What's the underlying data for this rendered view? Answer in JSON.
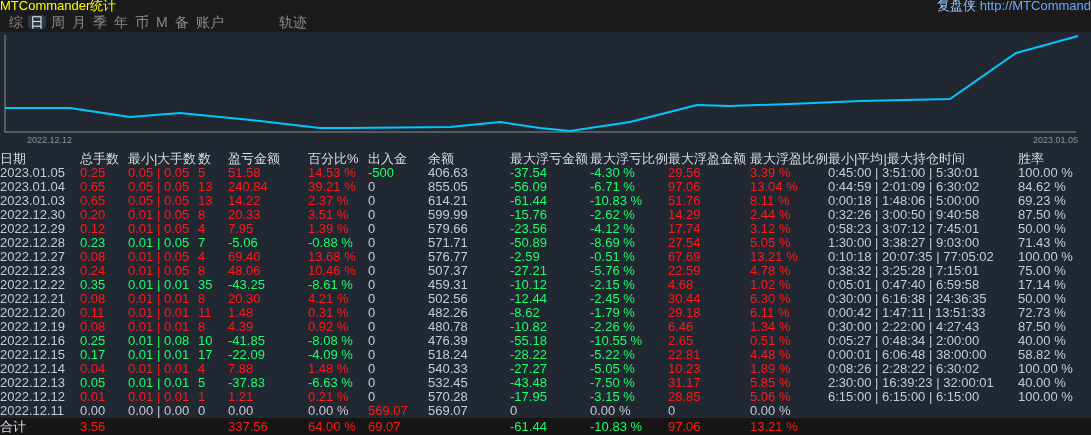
{
  "header": {
    "title": "MTCommander统计",
    "brand": "复盘侠",
    "link": "http://MTCommand"
  },
  "tabs": [
    {
      "label": "综",
      "selected": false
    },
    {
      "label": "日",
      "selected": true
    },
    {
      "label": "周",
      "selected": false
    },
    {
      "label": "月",
      "selected": false
    },
    {
      "label": "季",
      "selected": false
    },
    {
      "label": "年",
      "selected": false
    },
    {
      "label": "币",
      "selected": false
    },
    {
      "label": "M",
      "selected": false
    },
    {
      "label": "备",
      "selected": false
    },
    {
      "label": "账户",
      "selected": false
    },
    {
      "label": "轨迹",
      "selected": false
    }
  ],
  "chart": {
    "start_label": "2022.12.12",
    "end_label": "2023.01.05"
  },
  "table": {
    "columns": [
      "日期",
      "总手数",
      "最小|大手数",
      "数",
      "盈亏金额",
      "百分比%",
      "出入金",
      "余额",
      "最大浮亏金额",
      "最大浮亏比例",
      "最大浮盈金额",
      "最大浮盈比例",
      "最小|平均|最大持仓时间",
      "胜率"
    ],
    "rows": [
      {
        "kind": "profit",
        "cashflow": {
          "kind": "withdraw"
        },
        "cells": [
          "2023.01.05",
          "0.25",
          "0.05 | 0.05",
          "5",
          "51.58",
          "14.53 %",
          "-500",
          "406.63",
          "-37.54",
          "-4.30 %",
          "29.56",
          "3.39 %",
          "0:45:00 | 3:51:00 | 5:30:01",
          "100.00 %"
        ]
      },
      {
        "kind": "profit",
        "cashflow": {
          "kind": "none"
        },
        "cells": [
          "2023.01.04",
          "0.65",
          "0.05 | 0.05",
          "13",
          "240.84",
          "39.21 %",
          "0",
          "855.05",
          "-56.09",
          "-6.71 %",
          "97.06",
          "13.04 %",
          "0:44:59 | 2:01:09 | 6:30:02",
          "84.62 %"
        ]
      },
      {
        "kind": "profit",
        "cashflow": {
          "kind": "none"
        },
        "cells": [
          "2023.01.03",
          "0.65",
          "0.05 | 0.05",
          "13",
          "14.22",
          "2.37 %",
          "0",
          "614.21",
          "-61.44",
          "-10.83 %",
          "51.76",
          "8.11 %",
          "0:00:18 | 1:48:06 | 5:00:00",
          "69.23 %"
        ]
      },
      {
        "kind": "profit",
        "cashflow": {
          "kind": "none"
        },
        "cells": [
          "2022.12.30",
          "0.20",
          "0.01 | 0.05",
          "8",
          "20.33",
          "3.51 %",
          "0",
          "599.99",
          "-15.76",
          "-2.62 %",
          "14.29",
          "2.44 %",
          "0:32:26 | 3:00:50 | 9:40:58",
          "87.50 %"
        ]
      },
      {
        "kind": "profit",
        "cashflow": {
          "kind": "none"
        },
        "cells": [
          "2022.12.29",
          "0.12",
          "0.01 | 0.05",
          "4",
          "7.95",
          "1.39 %",
          "0",
          "579.66",
          "-23.56",
          "-4.12 %",
          "17.74",
          "3.12 %",
          "0:58:23 | 3:07:12 | 7:45:01",
          "50.00 %"
        ]
      },
      {
        "kind": "loss",
        "cashflow": {
          "kind": "none"
        },
        "cells": [
          "2022.12.28",
          "0.23",
          "0.01 | 0.05",
          "7",
          "-5.06",
          "-0.88 %",
          "0",
          "571.71",
          "-50.89",
          "-8.69 %",
          "27.54",
          "5.05 %",
          "1:30:00 | 3:38:27 | 9:03:00",
          "71.43 %"
        ]
      },
      {
        "kind": "profit",
        "cashflow": {
          "kind": "none"
        },
        "cells": [
          "2022.12.27",
          "0.08",
          "0.01 | 0.05",
          "4",
          "69.40",
          "13.68 %",
          "0",
          "576.77",
          "-2.59",
          "-0.51 %",
          "67.69",
          "13.21 %",
          "0:10:18 | 20:07:35 | 77:05:02",
          "100.00 %"
        ]
      },
      {
        "kind": "profit",
        "cashflow": {
          "kind": "none"
        },
        "cells": [
          "2022.12.23",
          "0.24",
          "0.01 | 0.05",
          "8",
          "48.06",
          "10.46 %",
          "0",
          "507.37",
          "-27.21",
          "-5.76 %",
          "22.59",
          "4.78 %",
          "0:38:32 | 3:25:28 | 7:15:01",
          "75.00 %"
        ]
      },
      {
        "kind": "loss",
        "cashflow": {
          "kind": "none"
        },
        "cells": [
          "2022.12.22",
          "0.35",
          "0.01 | 0.01",
          "35",
          "-43.25",
          "-8.61 %",
          "0",
          "459.31",
          "-10.12",
          "-2.15 %",
          "4.68",
          "1.02 %",
          "0:05:01 | 0:47:40 | 6:59:58",
          "17.14 %"
        ]
      },
      {
        "kind": "profit",
        "cashflow": {
          "kind": "none"
        },
        "cells": [
          "2022.12.21",
          "0.08",
          "0.01 | 0.01",
          "8",
          "20.30",
          "4.21 %",
          "0",
          "502.56",
          "-12.44",
          "-2.45 %",
          "30.44",
          "6.30 %",
          "0:30:00 | 6:16:38 | 24:36:35",
          "50.00 %"
        ]
      },
      {
        "kind": "profit",
        "cashflow": {
          "kind": "none"
        },
        "cells": [
          "2022.12.20",
          "0.11",
          "0.01 | 0.01",
          "11",
          "1.48",
          "0.31 %",
          "0",
          "482.26",
          "-8.62",
          "-1.79 %",
          "29.18",
          "6.11 %",
          "0:00:42 | 1:47:11 | 13:51:33",
          "72.73 %"
        ]
      },
      {
        "kind": "profit",
        "cashflow": {
          "kind": "none"
        },
        "cells": [
          "2022.12.19",
          "0.08",
          "0.01 | 0.01",
          "8",
          "4.39",
          "0.92 %",
          "0",
          "480.78",
          "-10.82",
          "-2.26 %",
          "6.46",
          "1.34 %",
          "0:30:00 | 2:22:00 | 4:27:43",
          "87.50 %"
        ]
      },
      {
        "kind": "loss",
        "cashflow": {
          "kind": "none"
        },
        "cells": [
          "2022.12.16",
          "0.25",
          "0.01 | 0.08",
          "10",
          "-41.85",
          "-8.08 %",
          "0",
          "476.39",
          "-55.18",
          "-10.55 %",
          "2.65",
          "0.51 %",
          "0:05:27 | 0:48:34 | 2:00:00",
          "40.00 %"
        ]
      },
      {
        "kind": "loss",
        "cashflow": {
          "kind": "none"
        },
        "cells": [
          "2022.12.15",
          "0.17",
          "0.01 | 0.01",
          "17",
          "-22.09",
          "-4.09 %",
          "0",
          "518.24",
          "-28.22",
          "-5.22 %",
          "22.81",
          "4.48 %",
          "0:00:01 | 6:06:48 | 38:00:00",
          "58.82 %"
        ]
      },
      {
        "kind": "profit",
        "cashflow": {
          "kind": "none"
        },
        "cells": [
          "2022.12.14",
          "0.04",
          "0.01 | 0.01",
          "4",
          "7.88",
          "1.48 %",
          "0",
          "540.33",
          "-27.27",
          "-5.05 %",
          "10.23",
          "1.89 %",
          "0:08:26 | 2:28:22 | 6:30:02",
          "100.00 %"
        ]
      },
      {
        "kind": "loss",
        "cashflow": {
          "kind": "none"
        },
        "cells": [
          "2022.12.13",
          "0.05",
          "0.01 | 0.01",
          "5",
          "-37.83",
          "-6.63 %",
          "0",
          "532.45",
          "-43.48",
          "-7.50 %",
          "31.17",
          "5.85 %",
          "2:30:00 | 16:39:23 | 32:00:01",
          "40.00 %"
        ]
      },
      {
        "kind": "profit",
        "cashflow": {
          "kind": "none"
        },
        "cells": [
          "2022.12.12",
          "0.01",
          "0.01 | 0.01",
          "1",
          "1.21",
          "0.21 %",
          "0",
          "570.28",
          "-17.95",
          "-3.15 %",
          "28.85",
          "5.06 %",
          "6:15:00 | 6:15:00 | 6:15:00",
          "100.00 %"
        ]
      },
      {
        "kind": "flat",
        "cashflow": {
          "kind": "deposit"
        },
        "cells": [
          "2022.12.11",
          "0.00",
          "0.00 | 0.00",
          "0",
          "0.00",
          "0.00 %",
          "569.07",
          "569.07",
          "0",
          "0.00 %",
          "0",
          "0.00 %",
          "",
          ""
        ]
      }
    ],
    "total": {
      "cashflow": {
        "kind": "deposit"
      },
      "cells": [
        "合计",
        "3.56",
        "",
        "",
        "337.56",
        "64.00 %",
        "69.07",
        "",
        "-61.44",
        "-10.83 %",
        "97.06",
        "13.21 %",
        "",
        ""
      ]
    }
  }
}
